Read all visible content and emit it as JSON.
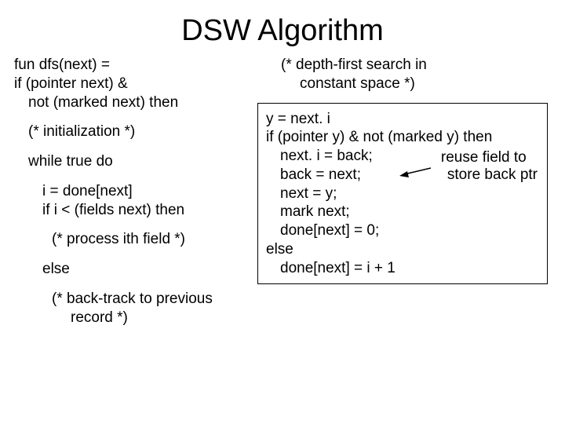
{
  "title": "DSW Algorithm",
  "left": {
    "l1": "fun dfs(next) =",
    "l2": "if (pointer next) &",
    "l3": "not (marked next) then",
    "init": "(* initialization *)",
    "while": "while true do",
    "i1": "i = done[next]",
    "i2": "if i < (fields next) then",
    "process": "(* process ith field *)",
    "else": "else",
    "back1": "(* back-track to previous",
    "back2": "record *)"
  },
  "right": {
    "c1": "(* depth-first search in",
    "c2": "constant space *)",
    "b1": "y = next. i",
    "b2": "if (pointer y) & not (marked y) then",
    "b3": "next. i = back;",
    "b4": "back = next;",
    "b5": "next = y;",
    "b6": "mark next;",
    "b7": "done[next] = 0;",
    "b8": "else",
    "b9": "done[next] = i + 1",
    "annot1": "reuse field to",
    "annot2": "store back ptr"
  }
}
